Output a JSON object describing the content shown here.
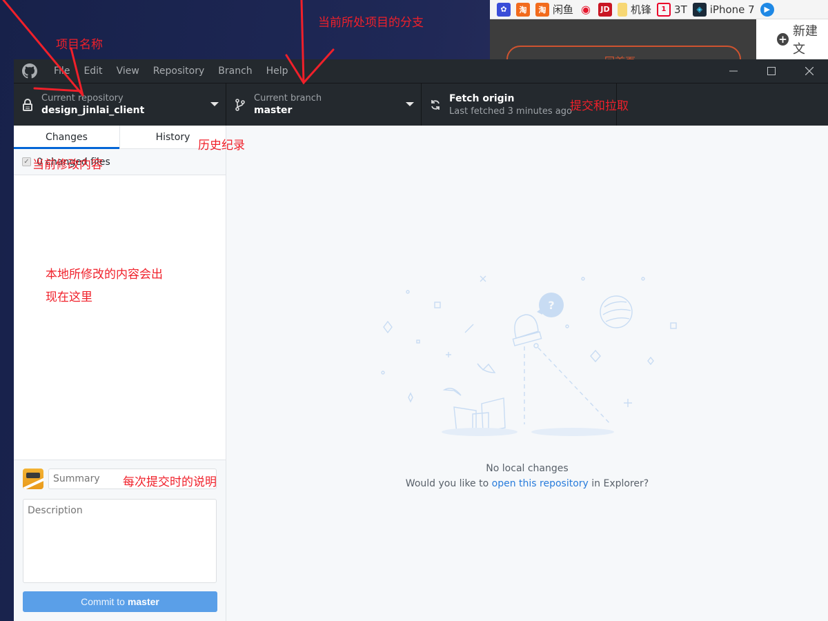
{
  "browser": {
    "bookmarks": [
      {
        "icon": "baidu-paw-icon",
        "label": "",
        "color": "#3a4dd8"
      },
      {
        "icon": "taobao-icon",
        "label": "",
        "color": "#f26b1d"
      },
      {
        "icon": "taobao-icon",
        "label": "闲鱼",
        "color": "#f26b1d"
      },
      {
        "icon": "weibo-icon",
        "label": "",
        "color": "#e6162d"
      },
      {
        "icon": "jd-icon",
        "label": "",
        "color": "#c91623"
      },
      {
        "icon": "folder-icon",
        "label": "机锋",
        "color": "#f7d774"
      },
      {
        "icon": "oneplus-icon",
        "label": "3T",
        "color": "#eb0029"
      },
      {
        "icon": "iphone-icon",
        "label": "iPhone 7",
        "color": "#1b2a38"
      },
      {
        "icon": "play-icon",
        "label": "",
        "color": "#1e88e5"
      }
    ],
    "jd_glyph": "JD",
    "tao_glyph": "淘",
    "side_button_label": "新建文",
    "orange_button_label": "回首页"
  },
  "window": {
    "menu": [
      "File",
      "Edit",
      "View",
      "Repository",
      "Branch",
      "Help"
    ],
    "controls": {
      "minimize": "—",
      "maximize": "☐",
      "close": "✕"
    }
  },
  "toolbar": {
    "repository": {
      "label": "Current repository",
      "value": "design_jinlai_client"
    },
    "branch": {
      "label": "Current branch",
      "value": "master"
    },
    "fetch": {
      "label": "Fetch origin",
      "value": "Last fetched 3 minutes ago"
    }
  },
  "sidebar": {
    "tabs": [
      {
        "label": "Changes",
        "active": true
      },
      {
        "label": "History",
        "active": false
      }
    ],
    "changes_header": "0 changed files",
    "commit": {
      "summary_placeholder": "Summary",
      "description_placeholder": "Description",
      "button_prefix": "Commit to",
      "button_branch": "master"
    }
  },
  "main": {
    "blank_title": "No local changes",
    "blank_prefix": "Would you like to ",
    "blank_link": "open this repository",
    "blank_suffix": " in Explorer?"
  },
  "annotations": {
    "project_name": "项目名称",
    "current_branch": "当前所处项目的分支",
    "fetch_push": "提交和拉取",
    "history": "历史纪录",
    "current_changes": "当前修改内容",
    "local_changes_line1": "本地所修改的内容会出",
    "local_changes_line2": "现在这里",
    "commit_description": "每次提交时的说明",
    "color": "#f0202a"
  }
}
